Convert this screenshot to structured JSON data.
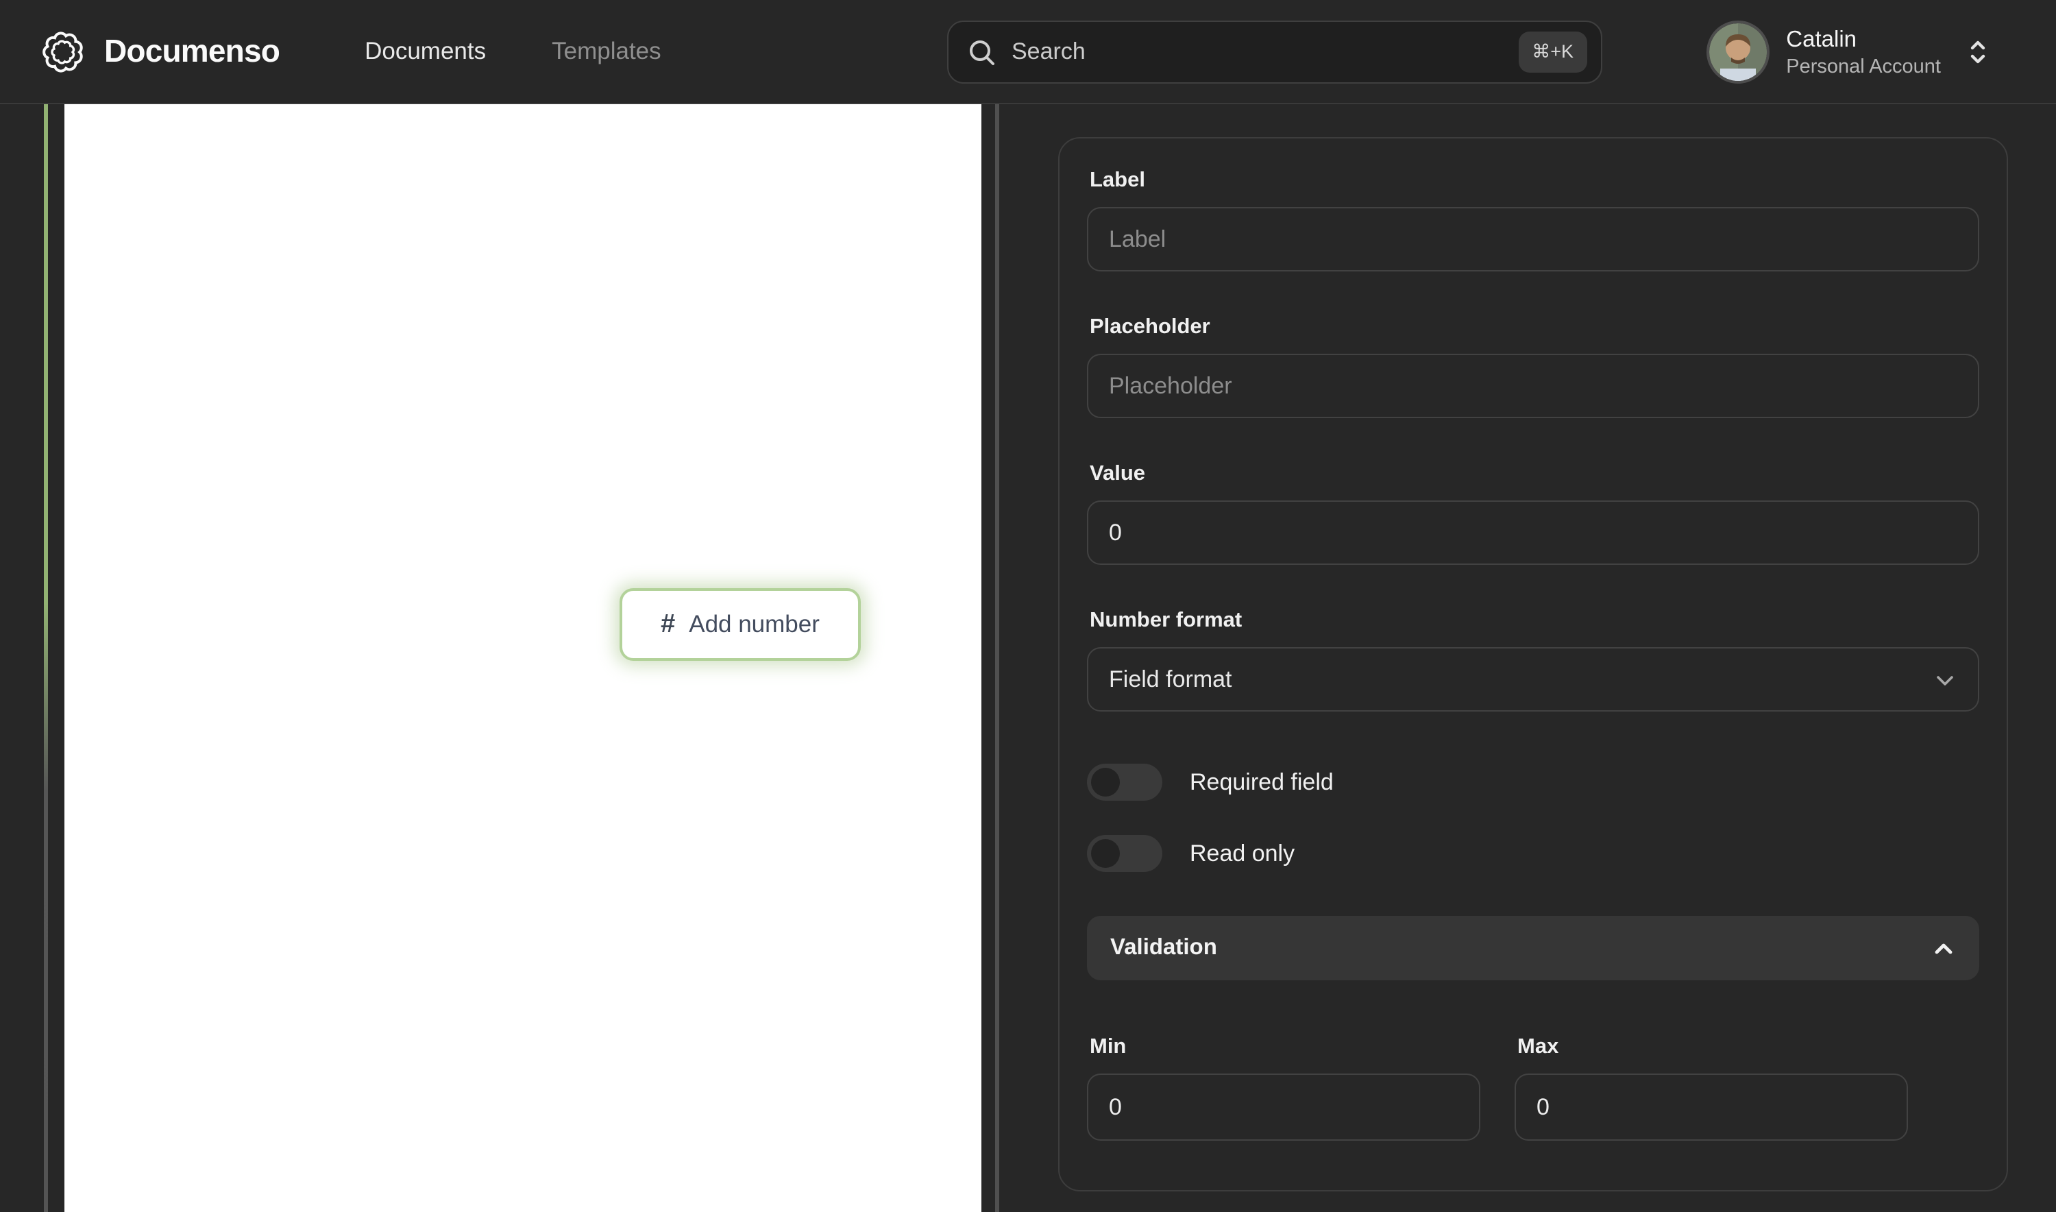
{
  "nav": {
    "brand": "Documenso",
    "items": [
      {
        "label": "Documents",
        "active": true
      },
      {
        "label": "Templates",
        "active": false
      }
    ],
    "search": {
      "placeholder": "Search",
      "shortcut": "⌘+K"
    },
    "account": {
      "name": "Catalin",
      "type": "Personal Account"
    }
  },
  "document": {
    "add_field_button": {
      "icon": "#",
      "label": "Add number"
    }
  },
  "panel": {
    "label_field": {
      "heading": "Label",
      "placeholder": "Label"
    },
    "placeholder_field": {
      "heading": "Placeholder",
      "placeholder": "Placeholder"
    },
    "value_field": {
      "heading": "Value",
      "value": "0"
    },
    "number_format": {
      "heading": "Number format",
      "selected": "Field format"
    },
    "required_toggle": {
      "label": "Required field",
      "state": "off"
    },
    "readonly_toggle": {
      "label": "Read only",
      "state": "off"
    },
    "validation": {
      "title": "Validation",
      "expanded": true
    },
    "min_field": {
      "label": "Min",
      "value": "0"
    },
    "max_field": {
      "label": "Max",
      "value": "0"
    }
  },
  "icons": {
    "brand": "documenso-rosette",
    "search": "magnifying-glass",
    "account_selector": "chevron-up-down",
    "number_field": "hash",
    "select_caret": "chevron-down",
    "validation_caret": "chevron-up"
  },
  "colors": {
    "background": "#272727",
    "accent_green": "#a3c385",
    "button_border_green": "#b3d29a",
    "page_white": "#ffffff",
    "panel_border": "#3d3d3d"
  }
}
